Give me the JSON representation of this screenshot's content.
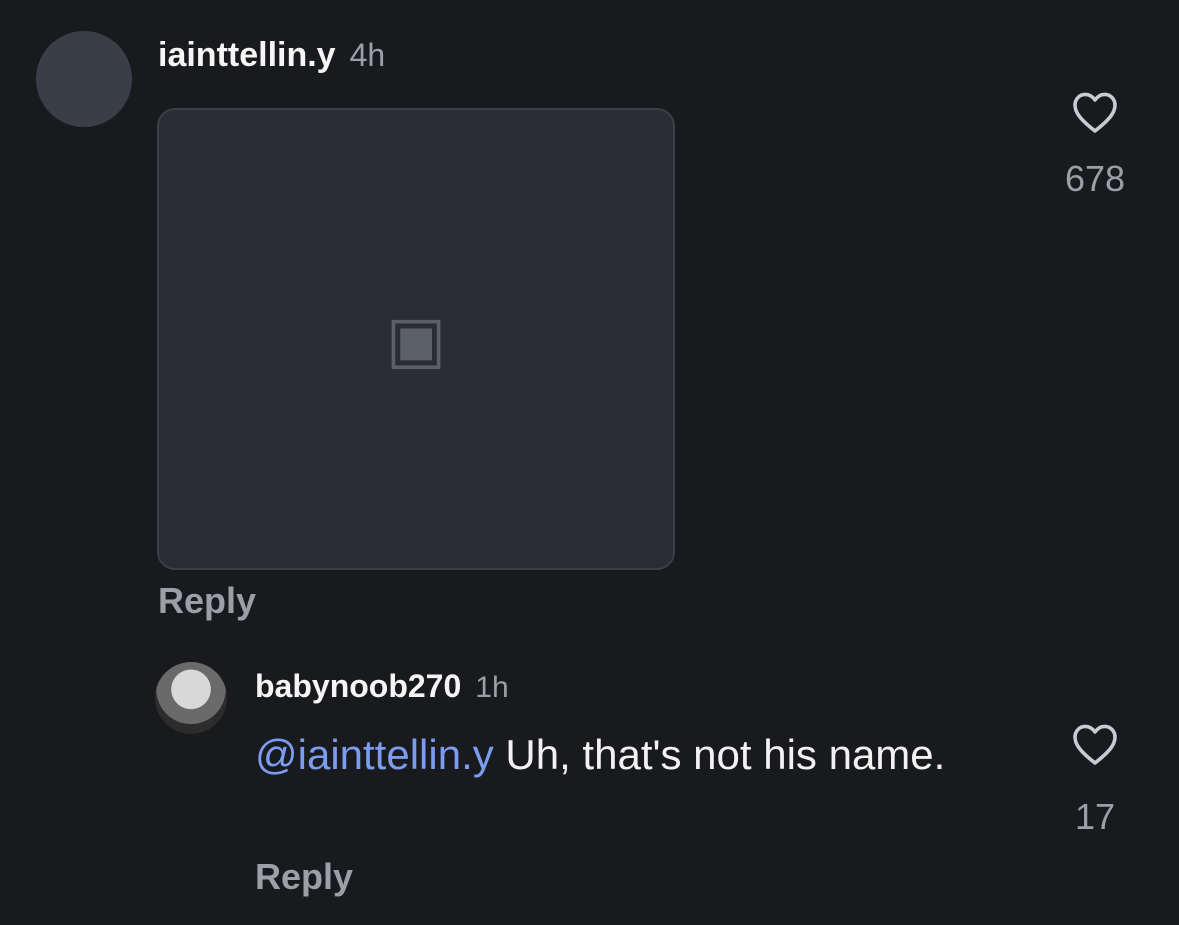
{
  "comments": [
    {
      "username": "iainttellin.y",
      "time": "4h",
      "likes": "678",
      "reply_label": "Reply"
    },
    {
      "username": "babynoob270",
      "time": "1h",
      "mention": "@iainttellin.y",
      "text": " Uh, that's not his name.",
      "likes": "17",
      "reply_label": "Reply"
    }
  ],
  "icons": {
    "like": "heart-outline-icon",
    "media": "image-icon"
  },
  "colors": {
    "background": "#181a1e",
    "mention": "#7c9cf0",
    "muted": "#9aa0a6"
  }
}
